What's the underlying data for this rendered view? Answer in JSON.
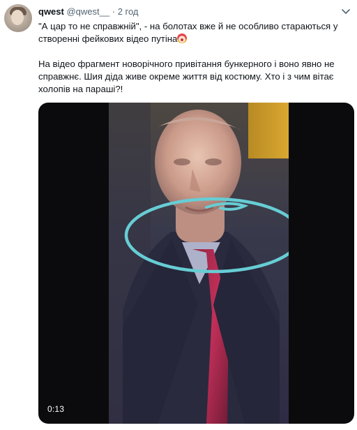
{
  "tweet": {
    "author_name": "qwest",
    "author_handle": "@qwest__",
    "separator": "·",
    "timestamp": "2 год",
    "paragraph1": "\"А цар то не справжній\", - на болотах вже й не особливо стараються у створенні фейкових відео путіна",
    "paragraph2": "На відео фрагмент новорічного привітання бункерного і воно явно не справжнє. Шия діда живе окреме життя від костюму. Хто і з чим вітає холопів на параші?!",
    "emoji_icon": "clown-face-icon"
  },
  "media": {
    "duration": "0:13",
    "annotation_color": "#5fd0d6"
  },
  "colors": {
    "text_primary": "#0f1419",
    "text_secondary": "#536471",
    "background": "#ffffff"
  }
}
